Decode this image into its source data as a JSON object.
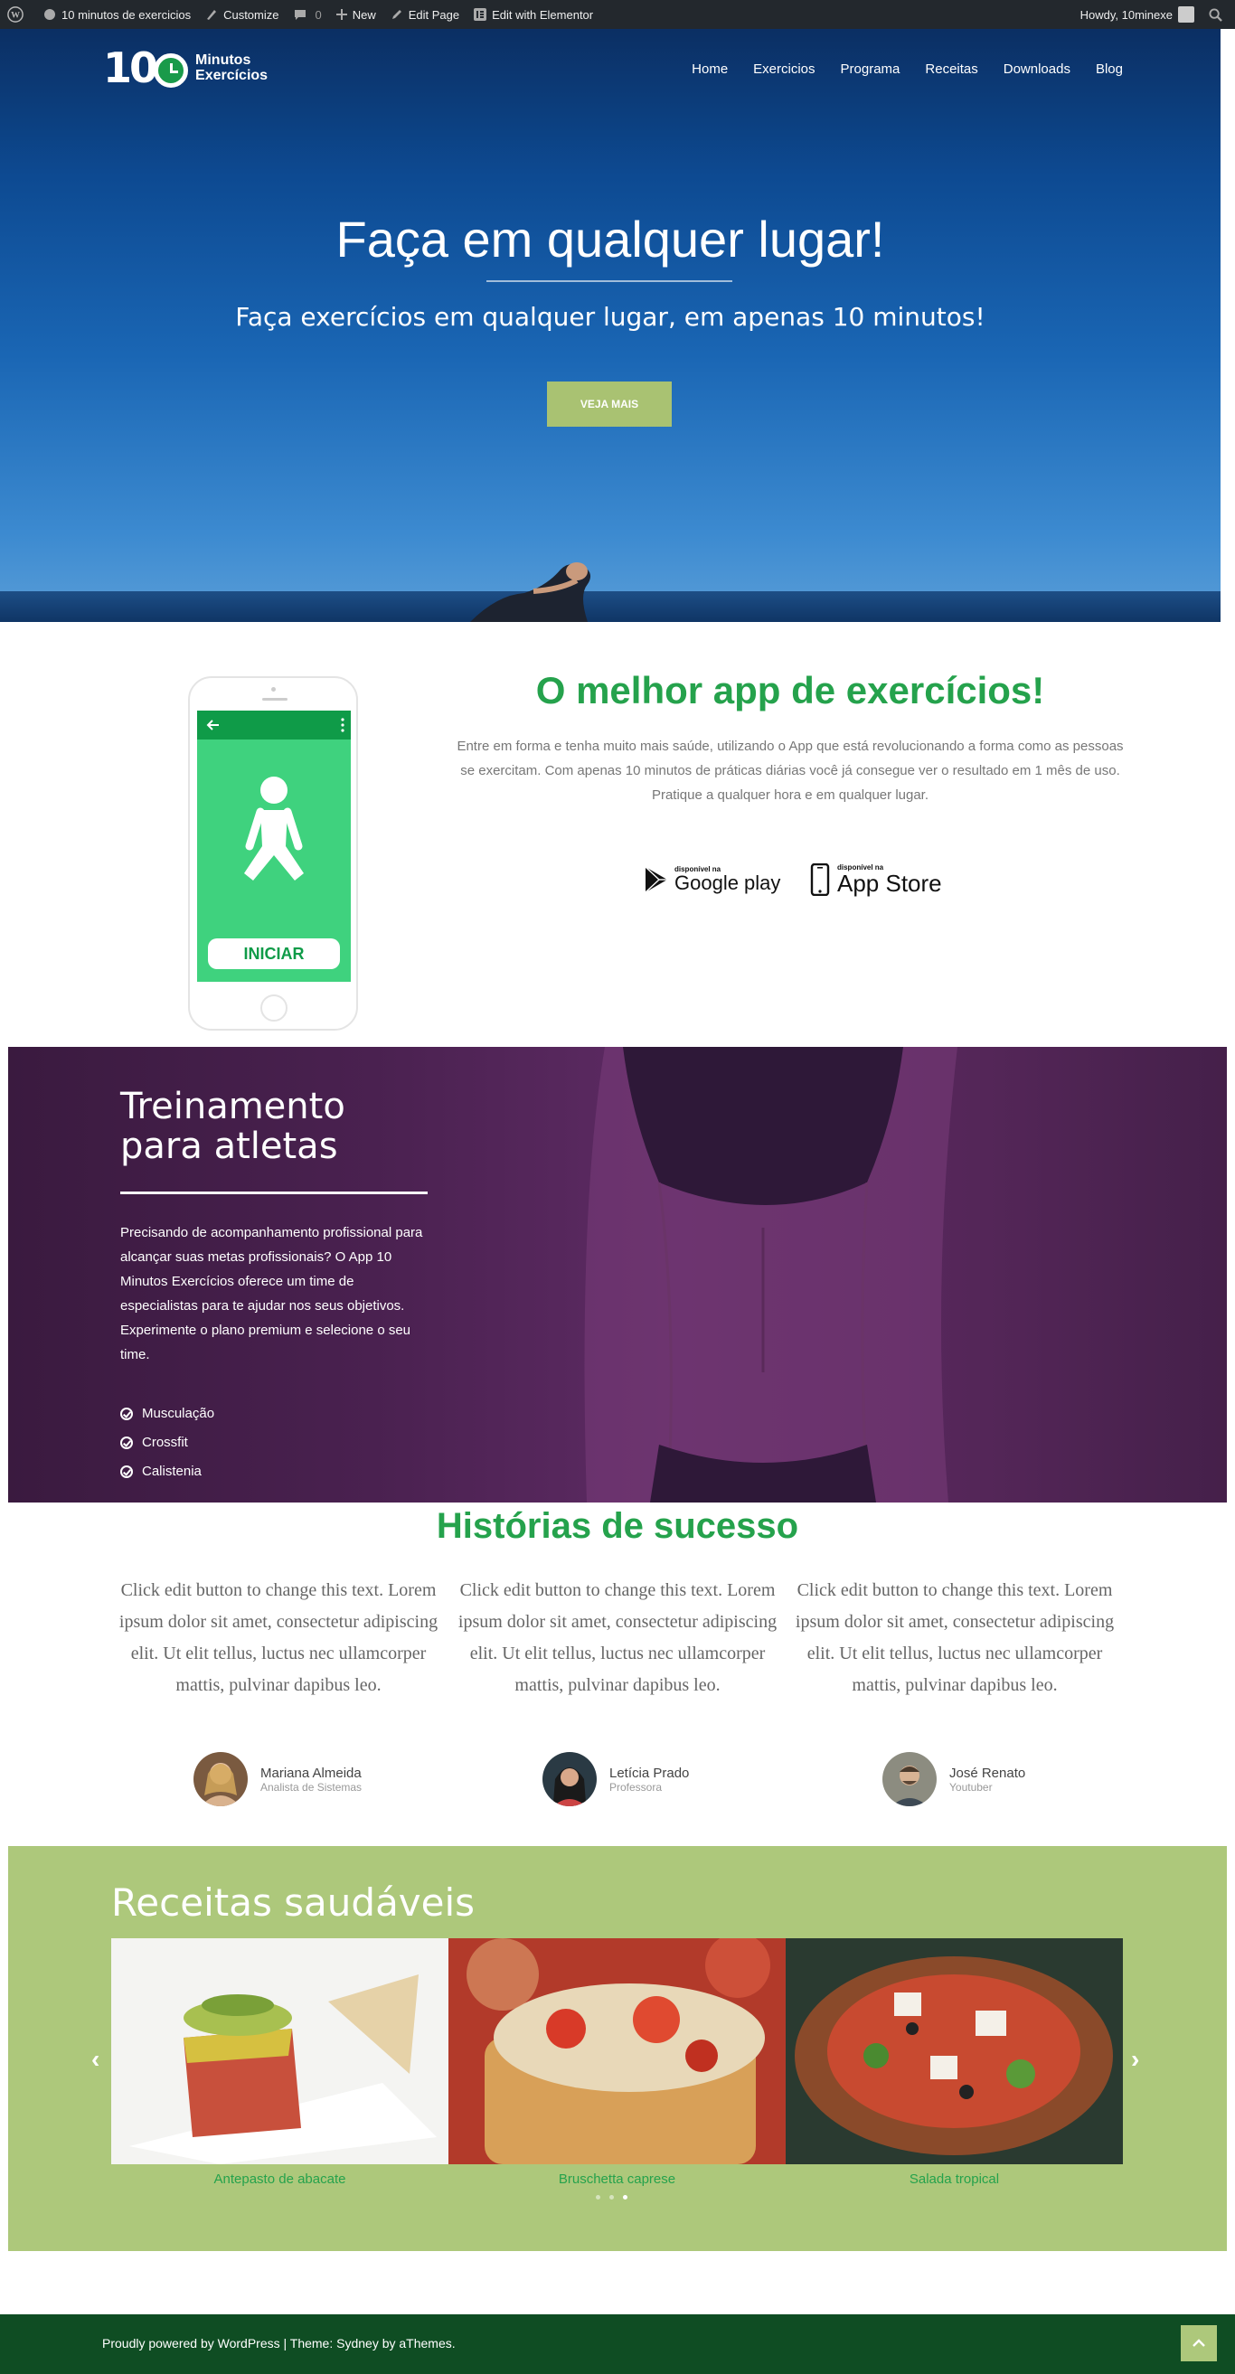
{
  "adminbar": {
    "site_name": "10 minutos de exercicios",
    "customize": "Customize",
    "comments_count": "0",
    "new": "New",
    "edit_page": "Edit Page",
    "edit_elementor": "Edit with Elementor",
    "howdy": "Howdy, 10minexe"
  },
  "header": {
    "logo_number": "10",
    "logo_line1": "Minutos",
    "logo_line2": "Exercícios",
    "nav": [
      "Home",
      "Exercicios",
      "Programa",
      "Receitas",
      "Downloads",
      "Blog"
    ]
  },
  "hero": {
    "title": "Faça em qualquer lugar!",
    "subtitle": "Faça exercícios em qualquer lugar, em apenas 10 minutos!",
    "button": "VEJA MAIS"
  },
  "app": {
    "phone_button": "INICIAR",
    "title": "O melhor app de exercícios!",
    "text": "Entre em forma e tenha muito mais saúde, utilizando o App que está revolucionando a forma como as pessoas se exercitam. Com apenas 10 minutos de práticas diárias você já consegue ver o resultado em 1 mês de uso. Pratique a qualquer hora e em qualquer lugar.",
    "google_small": "disponível na",
    "google_big": "Google play",
    "apple_small": "disponível na",
    "apple_big": "App Store"
  },
  "athletes": {
    "title_line1": "Treinamento",
    "title_line2": "para atletas",
    "text": "Precisando de acompanhamento profissional para alcançar suas metas profissionais? O App 10 Minutos Exercícios oferece um time de especialistas para te ajudar nos seus objetivos. Experimente o plano premium e selecione o seu time.",
    "list": [
      "Musculação",
      "Crossfit",
      "Calistenia"
    ]
  },
  "stories": {
    "title": "Histórias de sucesso",
    "items": [
      {
        "text": "Click edit button to change this text. Lorem ipsum dolor sit amet, consectetur adipiscing elit. Ut elit tellus, luctus nec ullamcorper mattis, pulvinar dapibus leo.",
        "name": "Mariana Almeida",
        "role": "Analista de Sistemas"
      },
      {
        "text": "Click edit button to change this text. Lorem ipsum dolor sit amet, consectetur adipiscing elit. Ut elit tellus, luctus nec ullamcorper mattis, pulvinar dapibus leo.",
        "name": "Letícia Prado",
        "role": "Professora"
      },
      {
        "text": "Click edit button to change this text. Lorem ipsum dolor sit amet, consectetur adipiscing elit. Ut elit tellus, luctus nec ullamcorper mattis, pulvinar dapibus leo.",
        "name": "José Renato",
        "role": "Youtuber"
      }
    ]
  },
  "recipes": {
    "title": "Receitas saudáveis",
    "items": [
      "Antepasto de abacate",
      "Bruschetta caprese",
      "Salada tropical"
    ],
    "active_dot": 3
  },
  "footer": {
    "text": "Proudly powered by WordPress | Theme: Sydney by aThemes."
  },
  "colors": {
    "brand_green": "#25a24c",
    "recipes_bg": "#adc87b",
    "footer_bg": "#0f4d23",
    "athletes_bg": "#4a2150"
  }
}
